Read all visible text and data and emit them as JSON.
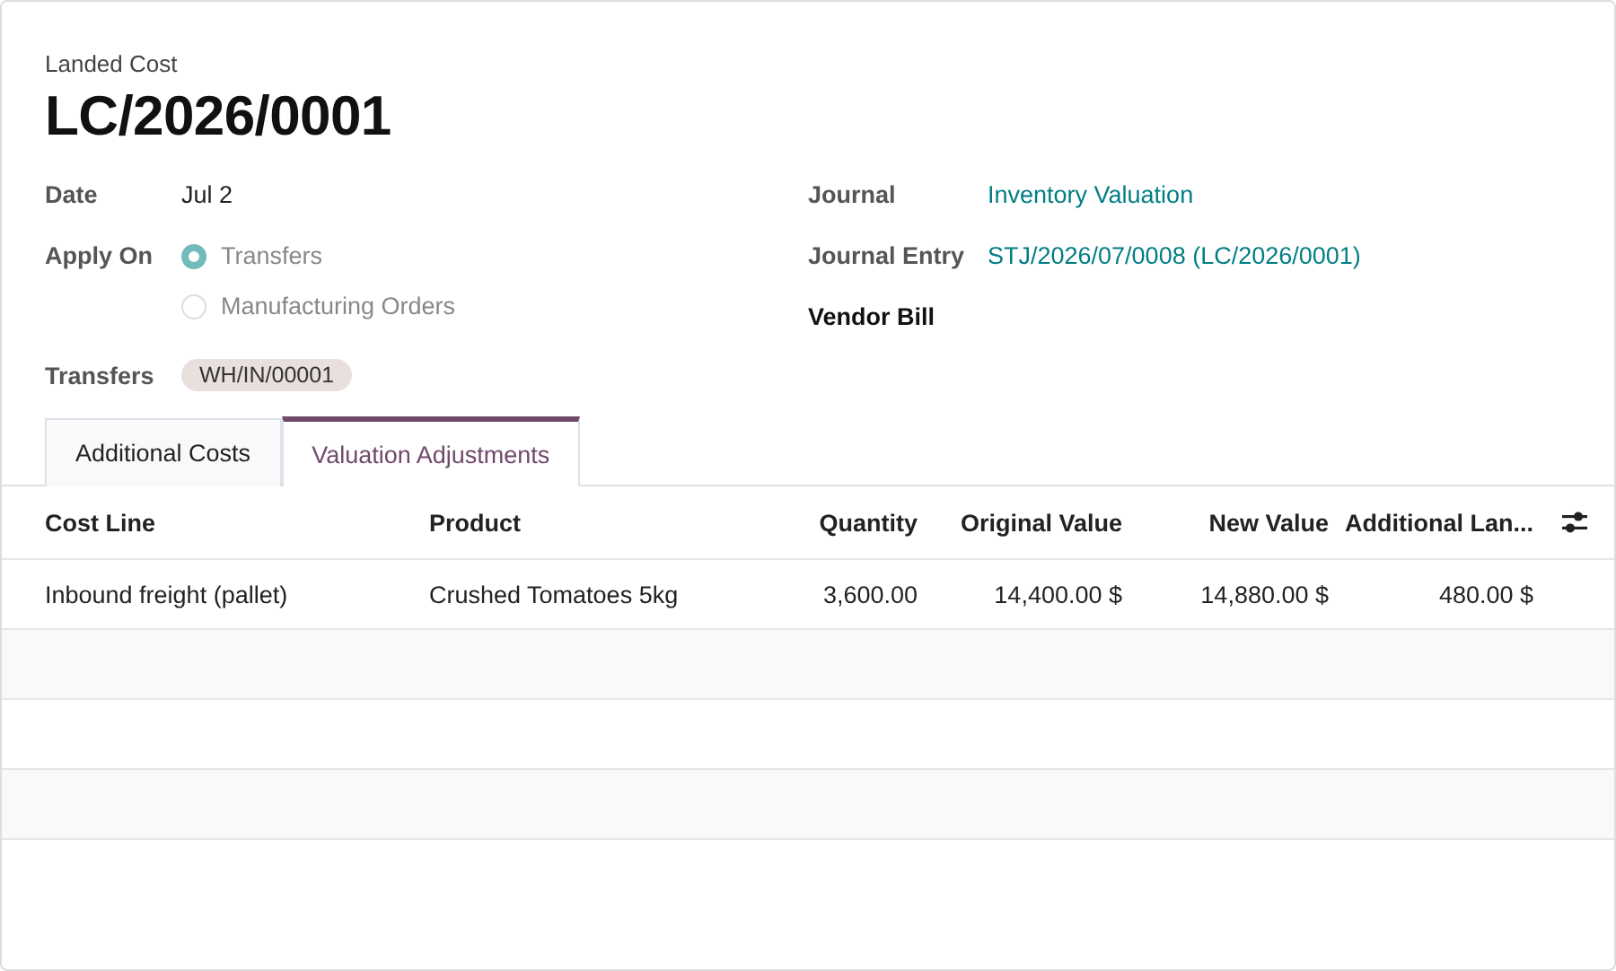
{
  "header": {
    "subtitle": "Landed Cost",
    "title": "LC/2026/0001"
  },
  "left_fields": {
    "date": {
      "label": "Date",
      "value": "Jul 2"
    },
    "apply_on": {
      "label": "Apply On",
      "options": [
        {
          "label": "Transfers",
          "selected": true
        },
        {
          "label": "Manufacturing Orders",
          "selected": false
        }
      ]
    },
    "transfers": {
      "label": "Transfers",
      "tags": [
        "WH/IN/00001"
      ]
    }
  },
  "right_fields": [
    {
      "label": "Journal",
      "value": "Inventory Valuation",
      "kind": "link"
    },
    {
      "label": "Journal Entry",
      "value": "STJ/2026/07/0008 (LC/2026/0001)",
      "kind": "link"
    },
    {
      "label": "Vendor Bill",
      "kind": "empty"
    }
  ],
  "tabs": [
    {
      "label": "Additional Costs",
      "selected": false
    },
    {
      "label": "Valuation Adjustments",
      "selected": true
    }
  ],
  "table": {
    "columns": [
      "Cost Line",
      "Product",
      "Quantity",
      "Original Value",
      "New Value",
      "Additional Lan..."
    ],
    "rows": [
      [
        "Inbound freight (pallet)",
        "Crushed Tomatoes 5kg",
        "3,600.00",
        "14,400.00 $",
        "14,880.00 $",
        "480.00 $"
      ]
    ]
  }
}
